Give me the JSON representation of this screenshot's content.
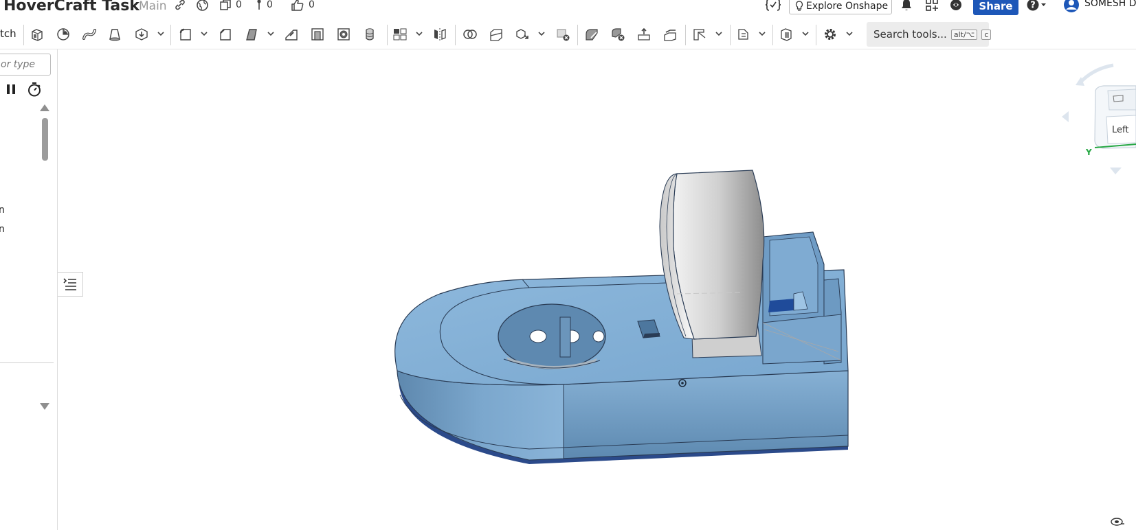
{
  "document": {
    "title": "HoverCraft Task",
    "branch": "Main",
    "versions_count": "0",
    "branches_count": "0",
    "likes_count": "0"
  },
  "header": {
    "explore_label": "Explore Onshape",
    "share_label": "Share",
    "user_name": "SOMESH D"
  },
  "toolbar": {
    "sketch_label": "tch",
    "search_tools_label": "Search tools...",
    "search_shortcut_1": "alt/⌥",
    "search_shortcut_2": "c"
  },
  "feature_panel": {
    "filter_placeholder": "or type",
    "items": [
      "n",
      "n"
    ]
  },
  "view_cube": {
    "face_label": "Left",
    "axis_y": "Y"
  },
  "colors": {
    "model_blue": "#7aa6cc",
    "fan_duct": "#d8d8d8",
    "share_blue": "#1d57b8",
    "axis_green": "#27a844"
  },
  "icons": {
    "link": "link-icon",
    "public": "globe-icon",
    "versions": "versions-icon",
    "branches": "branch-icon",
    "likes": "thumbs-up-icon",
    "notifications": "bell-icon",
    "apps": "apps-icon",
    "learning": "learning-center-icon",
    "help": "help-icon",
    "user": "user-avatar-icon"
  }
}
